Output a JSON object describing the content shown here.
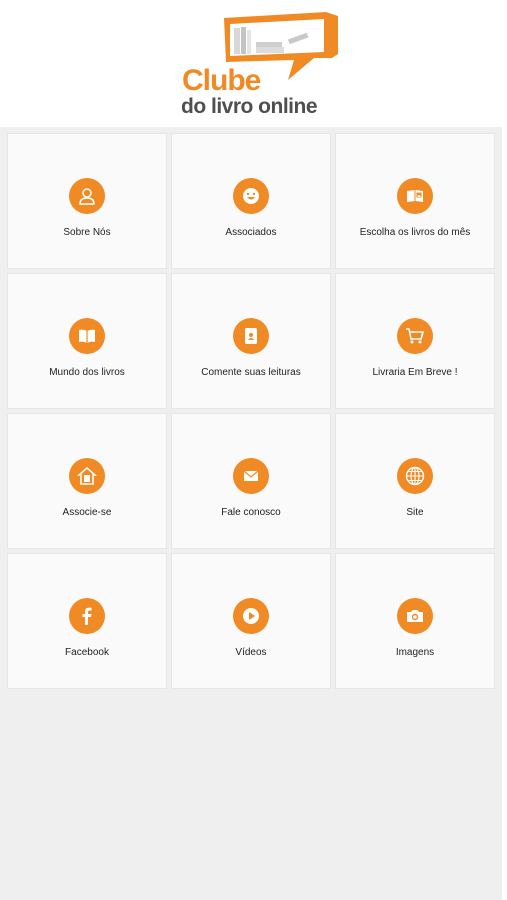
{
  "header": {
    "logo_line1": "Clube",
    "logo_line2": "do livro online"
  },
  "tiles": [
    {
      "label": "Sobre Nós",
      "icon": "user-icon"
    },
    {
      "label": "Associados",
      "icon": "smiley-icon"
    },
    {
      "label": "Escolha os livros do mês",
      "icon": "picture-book-icon"
    },
    {
      "label": "Mundo dos livros",
      "icon": "open-book-icon"
    },
    {
      "label": "Comente suas leituras",
      "icon": "note-icon"
    },
    {
      "label": "Livraria Em Breve !",
      "icon": "cart-icon"
    },
    {
      "label": "Associe-se",
      "icon": "house-tablet-icon"
    },
    {
      "label": "Fale conosco",
      "icon": "envelope-icon"
    },
    {
      "label": "Site",
      "icon": "globe-icon"
    },
    {
      "label": "Facebook",
      "icon": "facebook-icon"
    },
    {
      "label": "Vídeos",
      "icon": "play-icon"
    },
    {
      "label": "Imagens",
      "icon": "camera-icon"
    }
  ],
  "colors": {
    "accent": "#f08a24",
    "logo_gray": "#4f4f4f",
    "background": "#efefef",
    "tile": "#fafafa"
  }
}
